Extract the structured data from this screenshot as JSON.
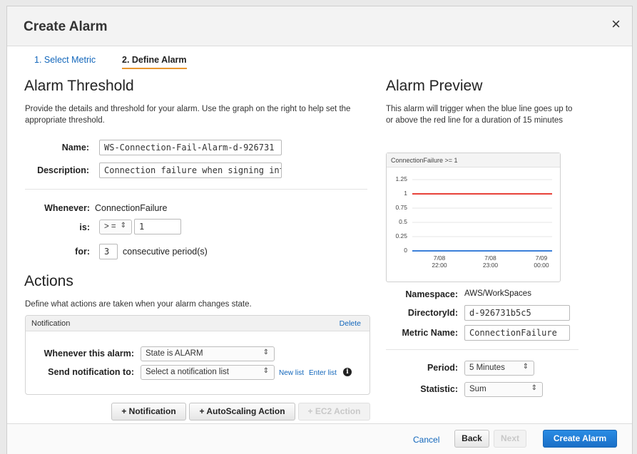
{
  "dialog": {
    "title": "Create Alarm",
    "close_label": "×"
  },
  "steps": {
    "step1": "1. Select Metric",
    "step2": "2. Define Alarm"
  },
  "threshold": {
    "heading": "Alarm Threshold",
    "description": "Provide the details and threshold for your alarm. Use the graph on the right to help set the appropriate threshold.",
    "name_label": "Name:",
    "name_value": "WS-Connection-Fail-Alarm-d-926731",
    "description_label": "Description:",
    "description_value": "Connection failure when signing into V",
    "whenever_label": "Whenever:",
    "whenever_value": "ConnectionFailure",
    "is_label": "is:",
    "operator": "> =",
    "threshold_value": "1",
    "for_label": "for:",
    "periods_value": "3",
    "periods_suffix": "consecutive period(s)"
  },
  "actions": {
    "heading": "Actions",
    "description": "Define what actions are taken when your alarm changes state.",
    "notification": {
      "title": "Notification",
      "delete_label": "Delete",
      "whenever_label": "Whenever this alarm:",
      "state_value": "State is ALARM",
      "send_label": "Send notification to:",
      "list_placeholder": "Select a notification list",
      "new_list": "New list",
      "enter_list": "Enter list",
      "info_glyph": "i"
    },
    "buttons": {
      "notification": "+ Notification",
      "autoscaling": "+ AutoScaling Action",
      "ec2": "+ EC2 Action"
    }
  },
  "preview": {
    "heading": "Alarm Preview",
    "description": "This alarm will trigger when the blue line goes up to or above the red line for a duration of 15 minutes",
    "namespace_label": "Namespace:",
    "namespace_value": "AWS/WorkSpaces",
    "directory_label": "DirectoryId:",
    "directory_value": "d-926731b5c5",
    "metric_label": "Metric Name:",
    "metric_value": "ConnectionFailure",
    "period_label": "Period:",
    "period_value": "5 Minutes",
    "statistic_label": "Statistic:",
    "statistic_value": "Sum"
  },
  "chart_data": {
    "type": "line",
    "title": "ConnectionFailure >= 1",
    "y_ticks": [
      "1.25",
      "1",
      "0.75",
      "0.5",
      "0.25",
      "0"
    ],
    "ylim": [
      0,
      1.25
    ],
    "x_ticks": [
      {
        "date": "7/08",
        "time": "22:00"
      },
      {
        "date": "7/08",
        "time": "23:00"
      },
      {
        "date": "7/09",
        "time": "00:00"
      }
    ],
    "series": [
      {
        "role": "threshold",
        "color": "#e8423a",
        "values": [
          1,
          1
        ]
      },
      {
        "role": "metric",
        "color": "#3b7fd9",
        "values": [
          0,
          0
        ]
      }
    ],
    "grid": true
  },
  "footer": {
    "cancel": "Cancel",
    "back": "Back",
    "next": "Next",
    "create": "Create Alarm"
  },
  "colors": {
    "link": "#1166bb",
    "active_tab_underline": "#e8962e",
    "primary": "#1a6fc7"
  }
}
